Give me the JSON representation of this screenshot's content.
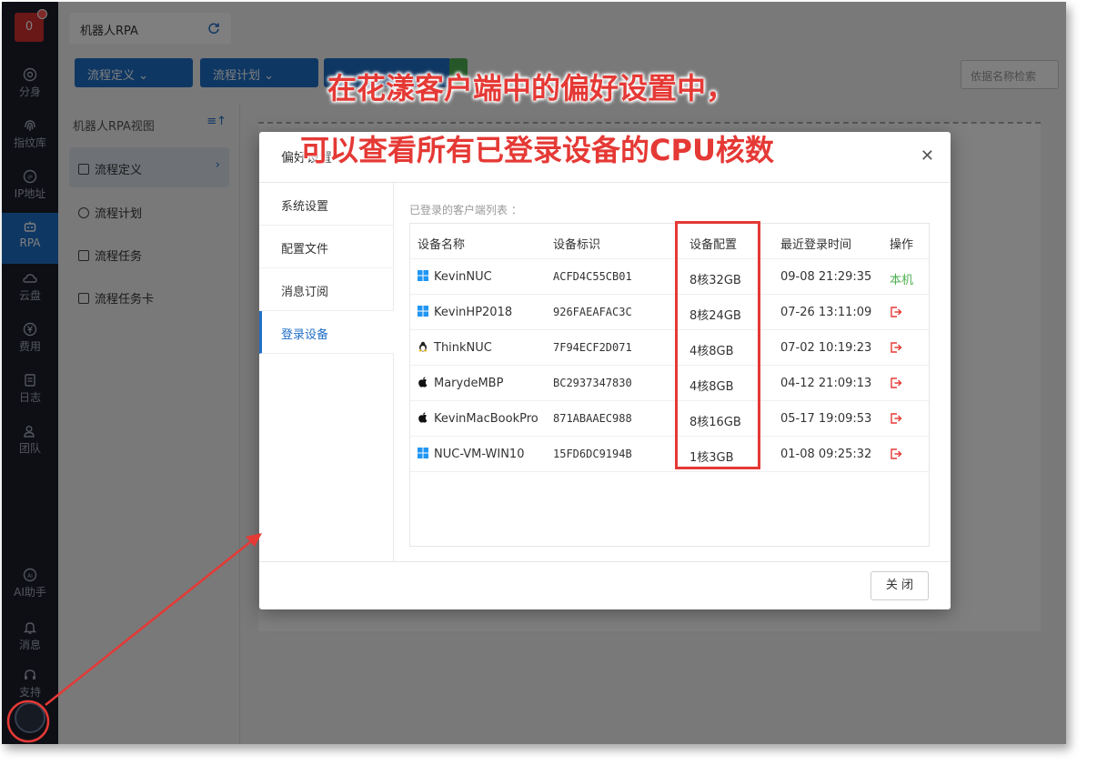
{
  "rail": {
    "badge": "0",
    "items": [
      {
        "label": "分身"
      },
      {
        "label": "指纹库"
      },
      {
        "label": "IP地址"
      },
      {
        "label": "RPA"
      },
      {
        "label": "云盘"
      },
      {
        "label": "费用"
      },
      {
        "label": "日志"
      },
      {
        "label": "团队"
      },
      {
        "label": "AI助手"
      },
      {
        "label": "消息"
      },
      {
        "label": "支持"
      }
    ]
  },
  "tab": {
    "title": "机器人RPA"
  },
  "toolbar": {
    "flow_def_label": "流程定义",
    "flow_plan_label": "流程计划",
    "search_placeholder": "依据名称检索"
  },
  "tree": {
    "header": "机器人RPA视图",
    "items": [
      {
        "label": "流程定义"
      },
      {
        "label": "流程计划"
      },
      {
        "label": "流程任务"
      },
      {
        "label": "流程任务卡"
      }
    ]
  },
  "modal": {
    "title": "偏好设置",
    "nav": [
      {
        "label": "系统设置"
      },
      {
        "label": "配置文件"
      },
      {
        "label": "消息订阅"
      },
      {
        "label": "登录设备"
      }
    ],
    "caption": "已登录的客户端列表 ：",
    "columns": [
      "设备名称",
      "设备标识",
      "设备配置",
      "最近登录时间",
      "操作"
    ],
    "rows": [
      {
        "name": "KevinNUC",
        "os": "windows",
        "id": "ACFD4C55CB01",
        "config": "8核32GB",
        "time": "09-08 21:29:35",
        "action": "本机"
      },
      {
        "name": "KevinHP2018",
        "os": "windows",
        "id": "926FAEAFAC3C",
        "config": "8核24GB",
        "time": "07-26 13:11:09",
        "action": ""
      },
      {
        "name": "ThinkNUC",
        "os": "linux",
        "id": "7F94ECF2D071",
        "config": "4核8GB",
        "time": "07-02 10:19:23",
        "action": ""
      },
      {
        "name": "MarydeMBP",
        "os": "apple",
        "id": "BC2937347830",
        "config": "4核8GB",
        "time": "04-12 21:09:13",
        "action": ""
      },
      {
        "name": "KevinMacBookPro",
        "os": "apple",
        "id": "871ABAAEC988",
        "config": "8核16GB",
        "time": "05-17 19:09:53",
        "action": ""
      },
      {
        "name": "NUC-VM-WIN10",
        "os": "windows",
        "id": "15FD6DC9194B",
        "config": "1核3GB",
        "time": "01-08 09:25:32",
        "action": ""
      }
    ],
    "close_button": "关 闭"
  },
  "annotation": {
    "line1": "在花漾客户端中的偏好设置中，",
    "line2": "可以查看所有已登录设备的CPU核数",
    "color": "#e53935"
  },
  "colors": {
    "accent": "#1f6fc7",
    "sidebar": "#1b1f2b",
    "success": "#4caf50",
    "danger": "#e53935"
  }
}
